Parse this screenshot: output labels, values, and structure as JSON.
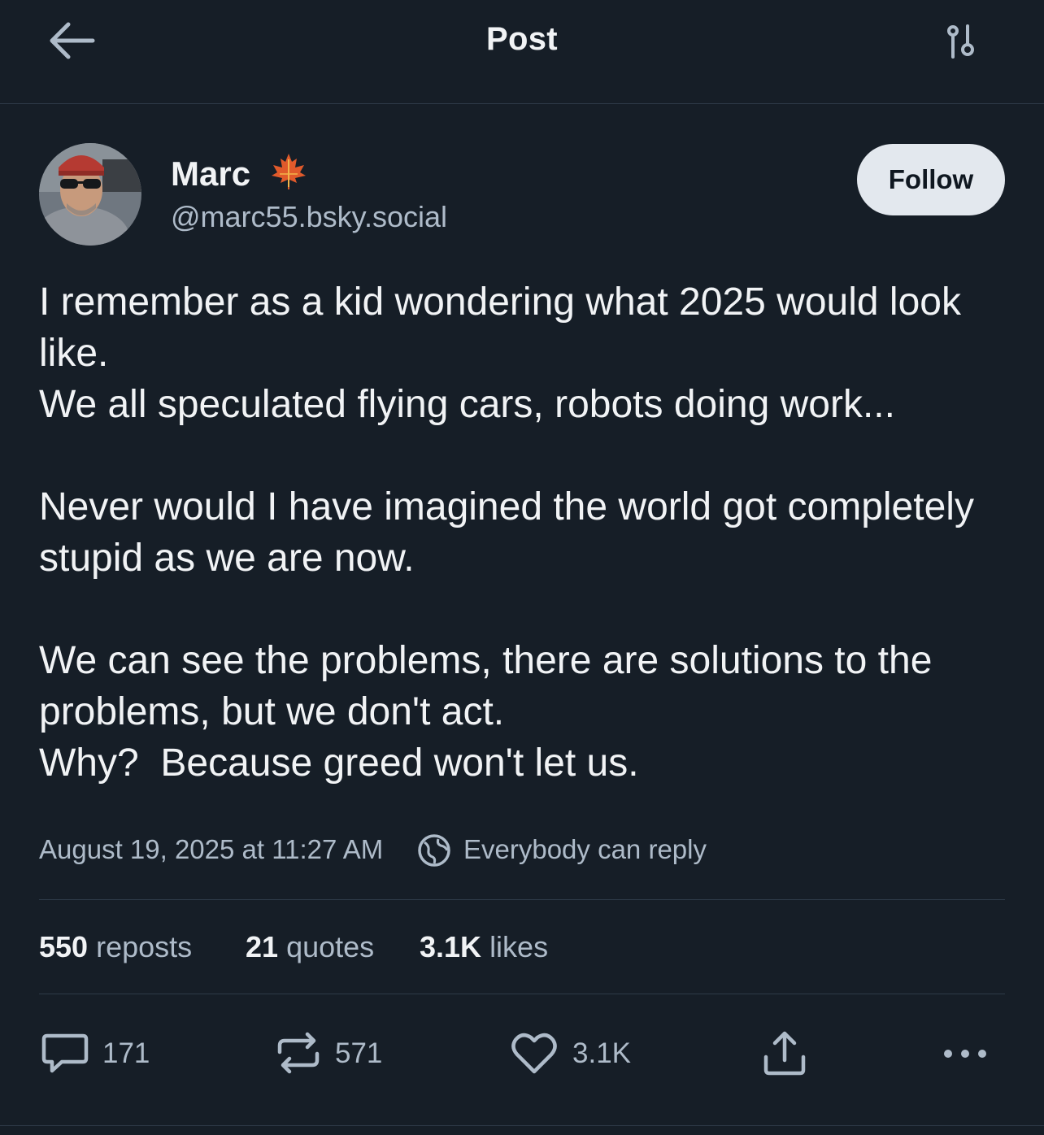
{
  "header": {
    "title": "Post",
    "back_icon": "arrow-left-icon",
    "filter_icon": "sliders-icon"
  },
  "author": {
    "name": "Marc",
    "badge_icon": "maple-leaf-icon",
    "handle": "@marc55.bsky.social",
    "follow_label": "Follow"
  },
  "post": {
    "text": "I remember as a kid wondering what 2025 would look like.\nWe all speculated flying cars, robots doing work...\n\nNever would I have imagined the world got completely stupid as we are now.\n\nWe can see the problems, there are solutions to the problems, but we don't act.\nWhy?  Because greed won't let us.",
    "timestamp": "August 19, 2025 at 11:27 AM",
    "reply_setting": "Everybody can reply"
  },
  "stats": {
    "reposts_count": "550",
    "reposts_label": "reposts",
    "quotes_count": "21",
    "quotes_label": "quotes",
    "likes_count": "3.1K",
    "likes_label": "likes"
  },
  "actions": {
    "reply_count": "171",
    "repost_count": "571",
    "like_count": "3.1K"
  },
  "colors": {
    "background": "#161e27",
    "text_primary": "#f1f3f5",
    "text_secondary": "#aebbc9",
    "divider": "#2e3a48",
    "follow_button_bg": "#e3e8ee"
  }
}
